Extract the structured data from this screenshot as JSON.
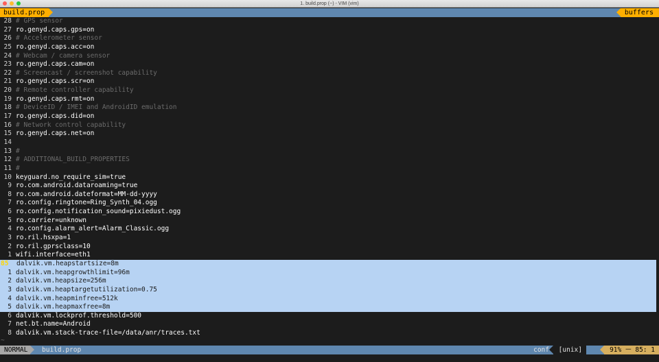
{
  "window": {
    "title": "1. build.prop (~) - VIM (vim)",
    "colors": {
      "close": "#fc5f57",
      "minimize": "#fdbc2e",
      "zoom": "#28c840"
    }
  },
  "tabline": {
    "active_tab": "build.prop",
    "buffers_label": "buffers"
  },
  "editor": {
    "lines": [
      {
        "num": "28",
        "text": "# GPS sensor",
        "comment": true
      },
      {
        "num": "27",
        "text": "ro.genyd.caps.gps=on"
      },
      {
        "num": "26",
        "text": "# Accelerometer sensor",
        "comment": true
      },
      {
        "num": "25",
        "text": "ro.genyd.caps.acc=on"
      },
      {
        "num": "24",
        "text": "# Webcam / camera sensor",
        "comment": true
      },
      {
        "num": "23",
        "text": "ro.genyd.caps.cam=on"
      },
      {
        "num": "22",
        "text": "# Screencast / screenshot capability",
        "comment": true
      },
      {
        "num": "21",
        "text": "ro.genyd.caps.scr=on"
      },
      {
        "num": "20",
        "text": "# Remote controller capability",
        "comment": true
      },
      {
        "num": "19",
        "text": "ro.genyd.caps.rmt=on"
      },
      {
        "num": "18",
        "text": "# DeviceID / IMEI and AndroidID emulation",
        "comment": true
      },
      {
        "num": "17",
        "text": "ro.genyd.caps.did=on"
      },
      {
        "num": "16",
        "text": "# Network control capability",
        "comment": true
      },
      {
        "num": "15",
        "text": "ro.genyd.caps.net=on"
      },
      {
        "num": "14",
        "text": ""
      },
      {
        "num": "13",
        "text": "#",
        "comment": true
      },
      {
        "num": "12",
        "text": "# ADDITIONAL_BUILD_PROPERTIES",
        "comment": true
      },
      {
        "num": "11",
        "text": "#",
        "comment": true
      },
      {
        "num": "10",
        "text": "keyguard.no_require_sim=true"
      },
      {
        "num": "9",
        "text": "ro.com.android.dataroaming=true"
      },
      {
        "num": "8",
        "text": "ro.com.android.dateformat=MM-dd-yyyy"
      },
      {
        "num": "7",
        "text": "ro.config.ringtone=Ring_Synth_04.ogg"
      },
      {
        "num": "6",
        "text": "ro.config.notification_sound=pixiedust.ogg"
      },
      {
        "num": "5",
        "text": "ro.carrier=unknown"
      },
      {
        "num": "4",
        "text": "ro.config.alarm_alert=Alarm_Classic.ogg"
      },
      {
        "num": "3",
        "text": "ro.ril.hsxpa=1"
      },
      {
        "num": "2",
        "text": "ro.ril.gprsclass=10"
      },
      {
        "num": "1",
        "text": "wifi.interface=eth1"
      },
      {
        "num": "85",
        "text": "dalvik.vm.heapstartsize=8m",
        "selected": true,
        "current": true
      },
      {
        "num": "1",
        "text": "dalvik.vm.heapgrowthlimit=96m",
        "selected": true
      },
      {
        "num": "2",
        "text": "dalvik.vm.heapsize=256m",
        "selected": true
      },
      {
        "num": "3",
        "text": "dalvik.vm.heaptargetutilization=0.75",
        "selected": true
      },
      {
        "num": "4",
        "text": "dalvik.vm.heapminfree=512k",
        "selected": true
      },
      {
        "num": "5",
        "text": "dalvik.vm.heapmaxfree=8m",
        "selected": true
      },
      {
        "num": "6",
        "text": "dalvik.vm.lockprof.threshold=500"
      },
      {
        "num": "7",
        "text": "net.bt.name=Android"
      },
      {
        "num": "8",
        "text": "dalvik.vm.stack-trace-file=/data/anr/traces.txt"
      }
    ],
    "tilde": "~"
  },
  "statusline": {
    "mode": "NORMAL",
    "filename": "build.prop",
    "filetype": "conf",
    "fileformat": "[unix]",
    "position": "91% ㅡ 85:  1"
  }
}
